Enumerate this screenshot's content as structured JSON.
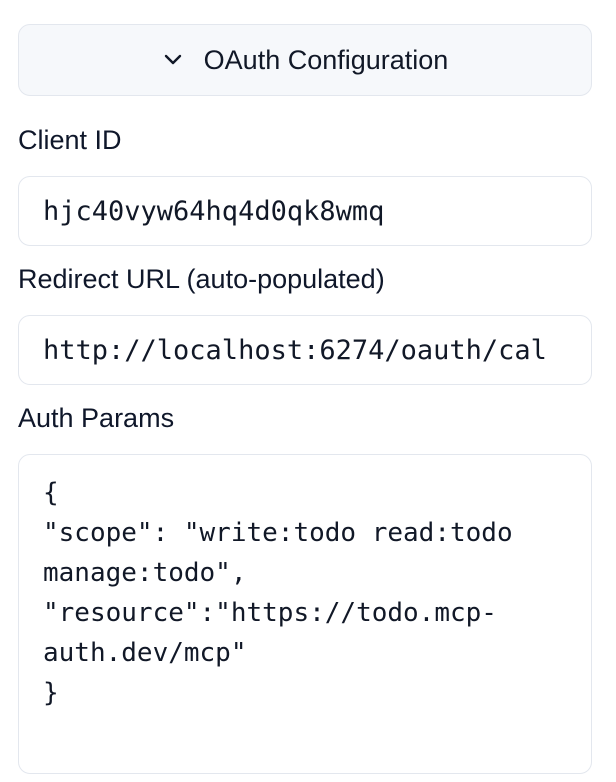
{
  "oauth": {
    "toggle_label": "OAuth Configuration",
    "toggle_icon": "chevron-down-icon"
  },
  "client_id": {
    "label": "Client ID",
    "value": "hjc40vyw64hq4d0qk8wmq"
  },
  "redirect_url": {
    "label": "Redirect URL (auto-populated)",
    "value": "http://localhost:6274/oauth/cal"
  },
  "auth_params": {
    "label": "Auth Params",
    "lines": [
      "{",
      "\"scope\": \"write:todo read:todo",
      "manage:todo\",",
      "\"resource\":\"https://todo.mcp-",
      "auth.dev/mcp\"",
      "}"
    ]
  },
  "colors": {
    "toggle_bg": "#f6f8fb",
    "border": "#e3e7ee",
    "text": "#0f172a"
  }
}
